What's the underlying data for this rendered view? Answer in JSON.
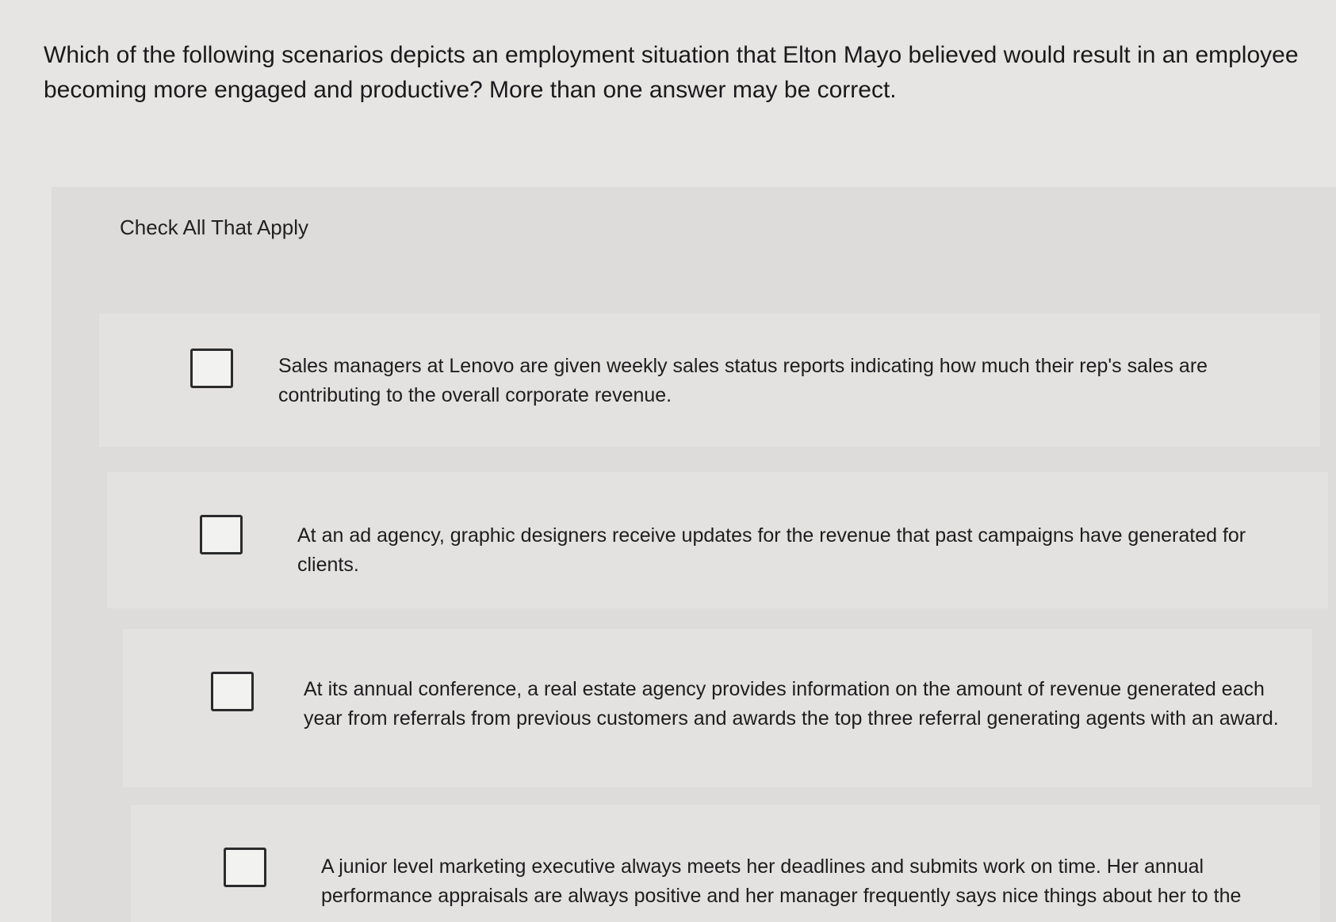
{
  "question": {
    "text": "Which of the following scenarios depicts an employment situation that Elton Mayo believed would result in an employee becoming more engaged and productive? More than one answer may be correct."
  },
  "instruction": "Check All That Apply",
  "options": [
    {
      "text": "Sales managers at Lenovo are given weekly sales status reports indicating how much their rep's sales are contributing to the overall corporate revenue.",
      "checked": false
    },
    {
      "text": "At an ad agency, graphic designers receive updates for the revenue that past campaigns have generated for clients.",
      "checked": false
    },
    {
      "text": "At its annual conference, a real estate agency provides information on the amount of revenue generated each year from referrals from previous customers and awards the top three referral generating agents with an award.",
      "checked": false
    },
    {
      "text": "A junior level marketing executive always meets her deadlines and submits work on time. Her annual performance appraisals are always positive and her manager frequently says nice things about her to the",
      "checked": false
    }
  ]
}
